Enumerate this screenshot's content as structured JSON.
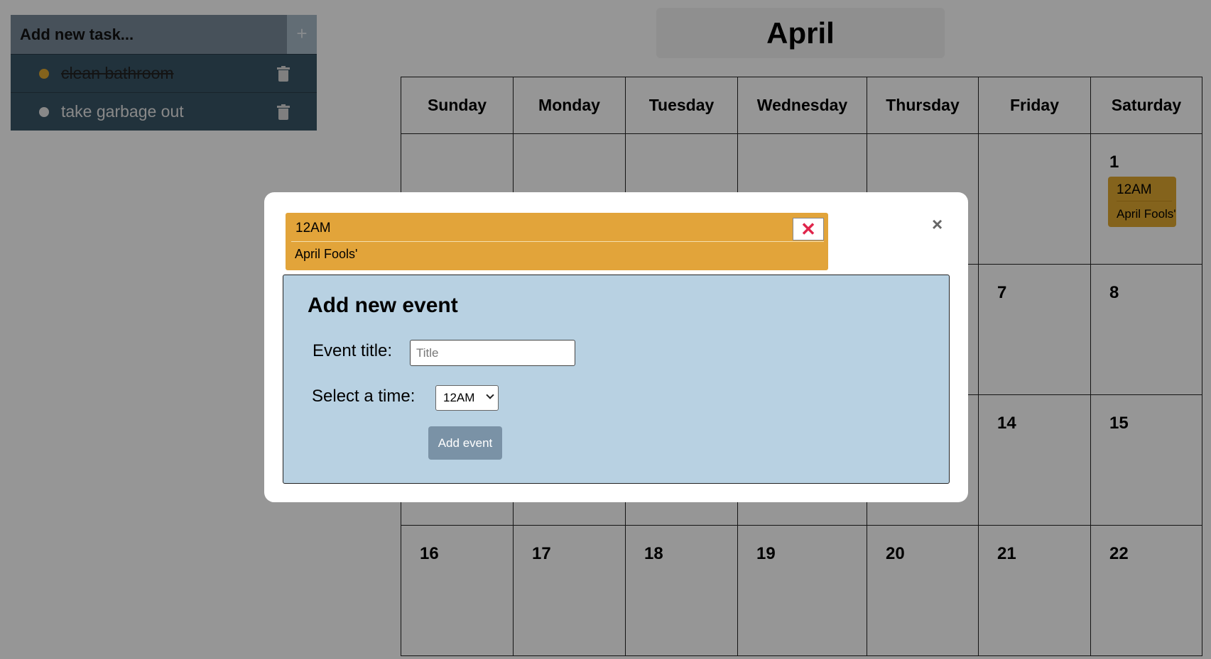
{
  "tasks": {
    "add_placeholder": "Add new task...",
    "add_button": "+",
    "items": [
      {
        "text": "clean bathroom",
        "done": true,
        "dot_color": "#e0a930"
      },
      {
        "text": "take garbage out",
        "done": false,
        "dot_color": "#e8e8e8"
      }
    ]
  },
  "calendar": {
    "month": "April",
    "weekdays": [
      "Sunday",
      "Monday",
      "Tuesday",
      "Wednesday",
      "Thursday",
      "Friday",
      "Saturday"
    ],
    "weeks": [
      [
        "",
        "",
        "",
        "",
        "",
        "",
        "1"
      ],
      [
        "",
        "",
        "",
        "",
        "",
        "7",
        "8"
      ],
      [
        "",
        "",
        "",
        "",
        "",
        "14",
        "15"
      ],
      [
        "16",
        "17",
        "18",
        "19",
        "20",
        "21",
        "22"
      ]
    ],
    "day_event": {
      "time": "12AM",
      "title": "April Fools'"
    }
  },
  "modal": {
    "close": "×",
    "event": {
      "time": "12AM",
      "title": "April Fools'",
      "delete": "✕"
    },
    "form": {
      "heading": "Add new event",
      "title_label": "Event title:",
      "title_placeholder": "Title",
      "time_label": "Select a time:",
      "time_value": "12AM",
      "submit": "Add event"
    }
  },
  "colors": {
    "event": "#e2a43a",
    "form_bg": "#b8d1e2",
    "task_bg": "#395566",
    "delete_x": "#e0254b"
  }
}
